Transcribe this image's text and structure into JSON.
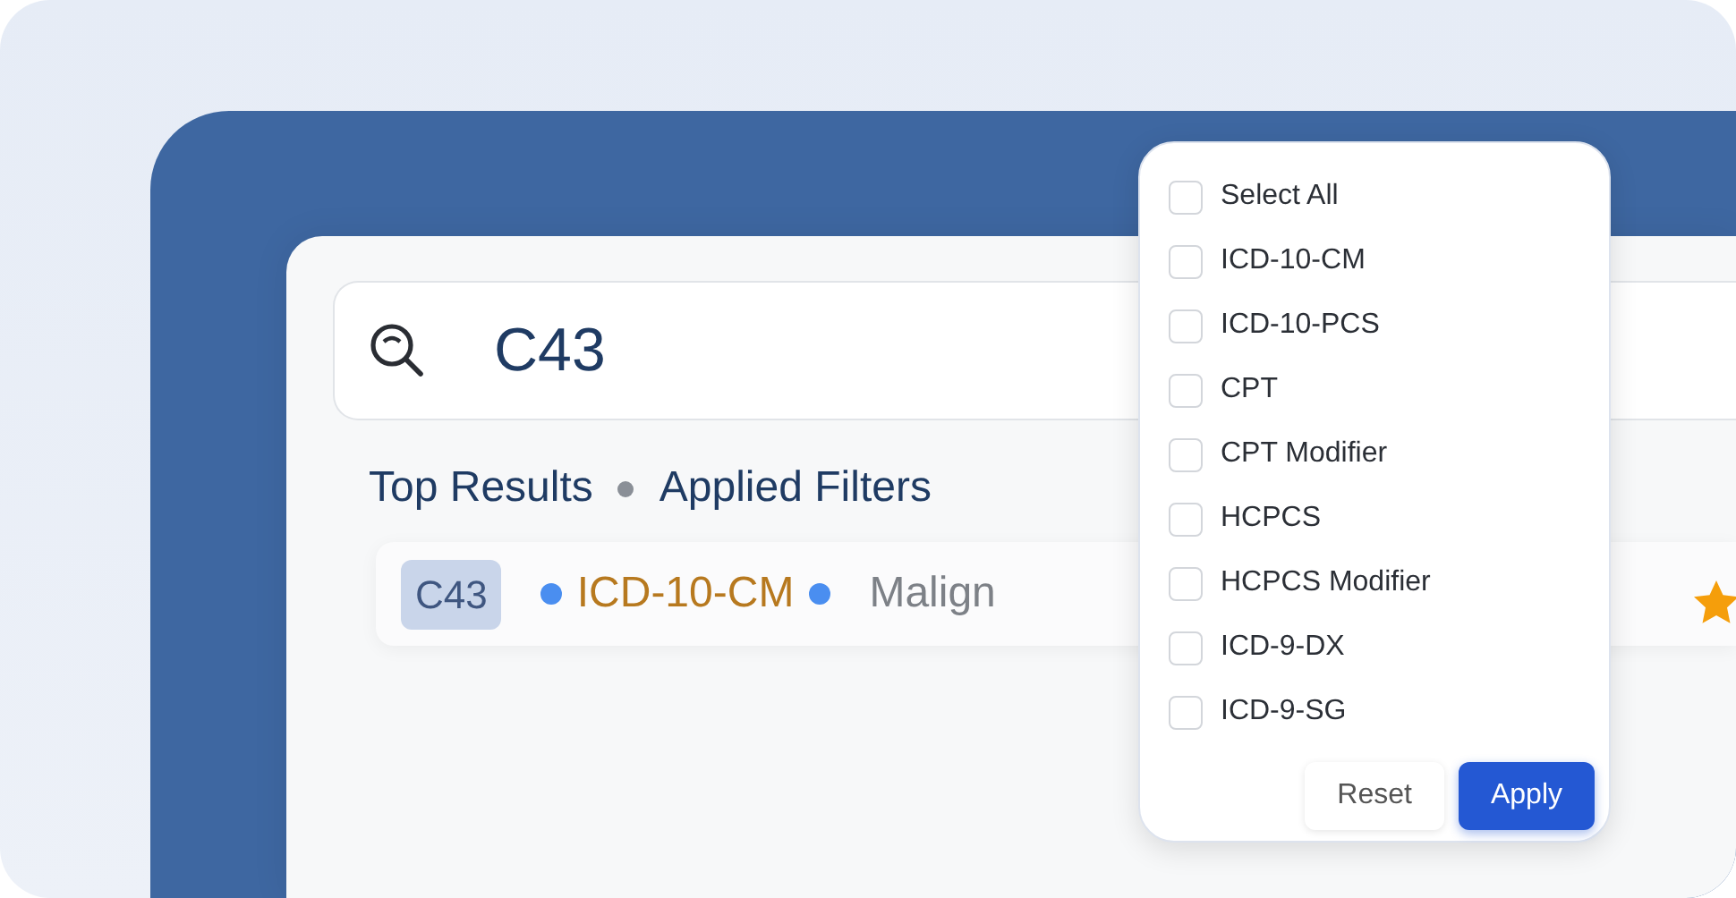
{
  "search": {
    "value": "C43"
  },
  "tabs": [
    {
      "label": "Top Results",
      "selected": false
    },
    {
      "label": "Applied Filters",
      "selected": false
    }
  ],
  "result": {
    "code": "C43",
    "system": "ICD-10-CM",
    "description": "Malign",
    "starred": true
  },
  "filter_menu": {
    "options": [
      {
        "label": "Select All",
        "checked": false
      },
      {
        "label": "ICD-10-CM",
        "checked": false
      },
      {
        "label": "ICD-10-PCS",
        "checked": false
      },
      {
        "label": "CPT",
        "checked": false
      },
      {
        "label": "CPT Modifier",
        "checked": false
      },
      {
        "label": "HCPCS",
        "checked": false
      },
      {
        "label": "HCPCS Modifier",
        "checked": false
      },
      {
        "label": "ICD-9-DX",
        "checked": false
      },
      {
        "label": "ICD-9-SG",
        "checked": false
      }
    ],
    "buttons": [
      {
        "label": "Reset",
        "kind": "secondary"
      },
      {
        "label": "Apply",
        "kind": "primary"
      }
    ]
  }
}
